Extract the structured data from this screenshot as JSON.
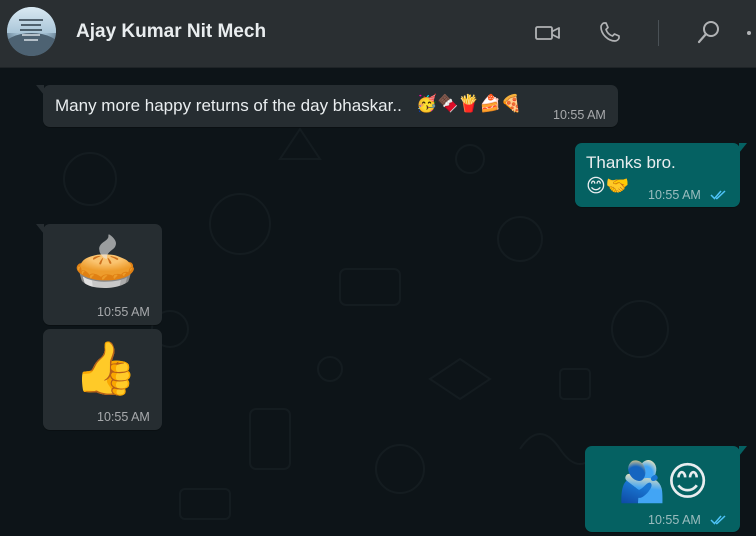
{
  "header": {
    "contact_name": "Ajay Kumar Nit Mech",
    "icons": [
      "video-call-icon",
      "voice-call-icon",
      "search-icon",
      "menu-icon"
    ]
  },
  "colors": {
    "header_bg": "#2a2f32",
    "chat_bg": "#0d1418",
    "incoming_bubble": "#262d31",
    "outgoing_bubble": "#056162",
    "read_ticks": "#4fc3f7"
  },
  "messages": [
    {
      "direction": "incoming",
      "text": "Many more happy returns of the day bhaskar..",
      "emoji": "🥳🍫🍟🍰🍕",
      "time": "10:55 AM"
    },
    {
      "direction": "outgoing",
      "text": "Thanks bro.",
      "emoji": "😊🤝",
      "time": "10:55 AM",
      "status": "read"
    },
    {
      "direction": "incoming",
      "sticker": "🥧",
      "time": "10:55 AM"
    },
    {
      "direction": "incoming",
      "sticker": "👍",
      "time": "10:55 AM"
    },
    {
      "direction": "outgoing",
      "sticker": "🫂😊",
      "time": "10:55 AM",
      "status": "read"
    }
  ]
}
